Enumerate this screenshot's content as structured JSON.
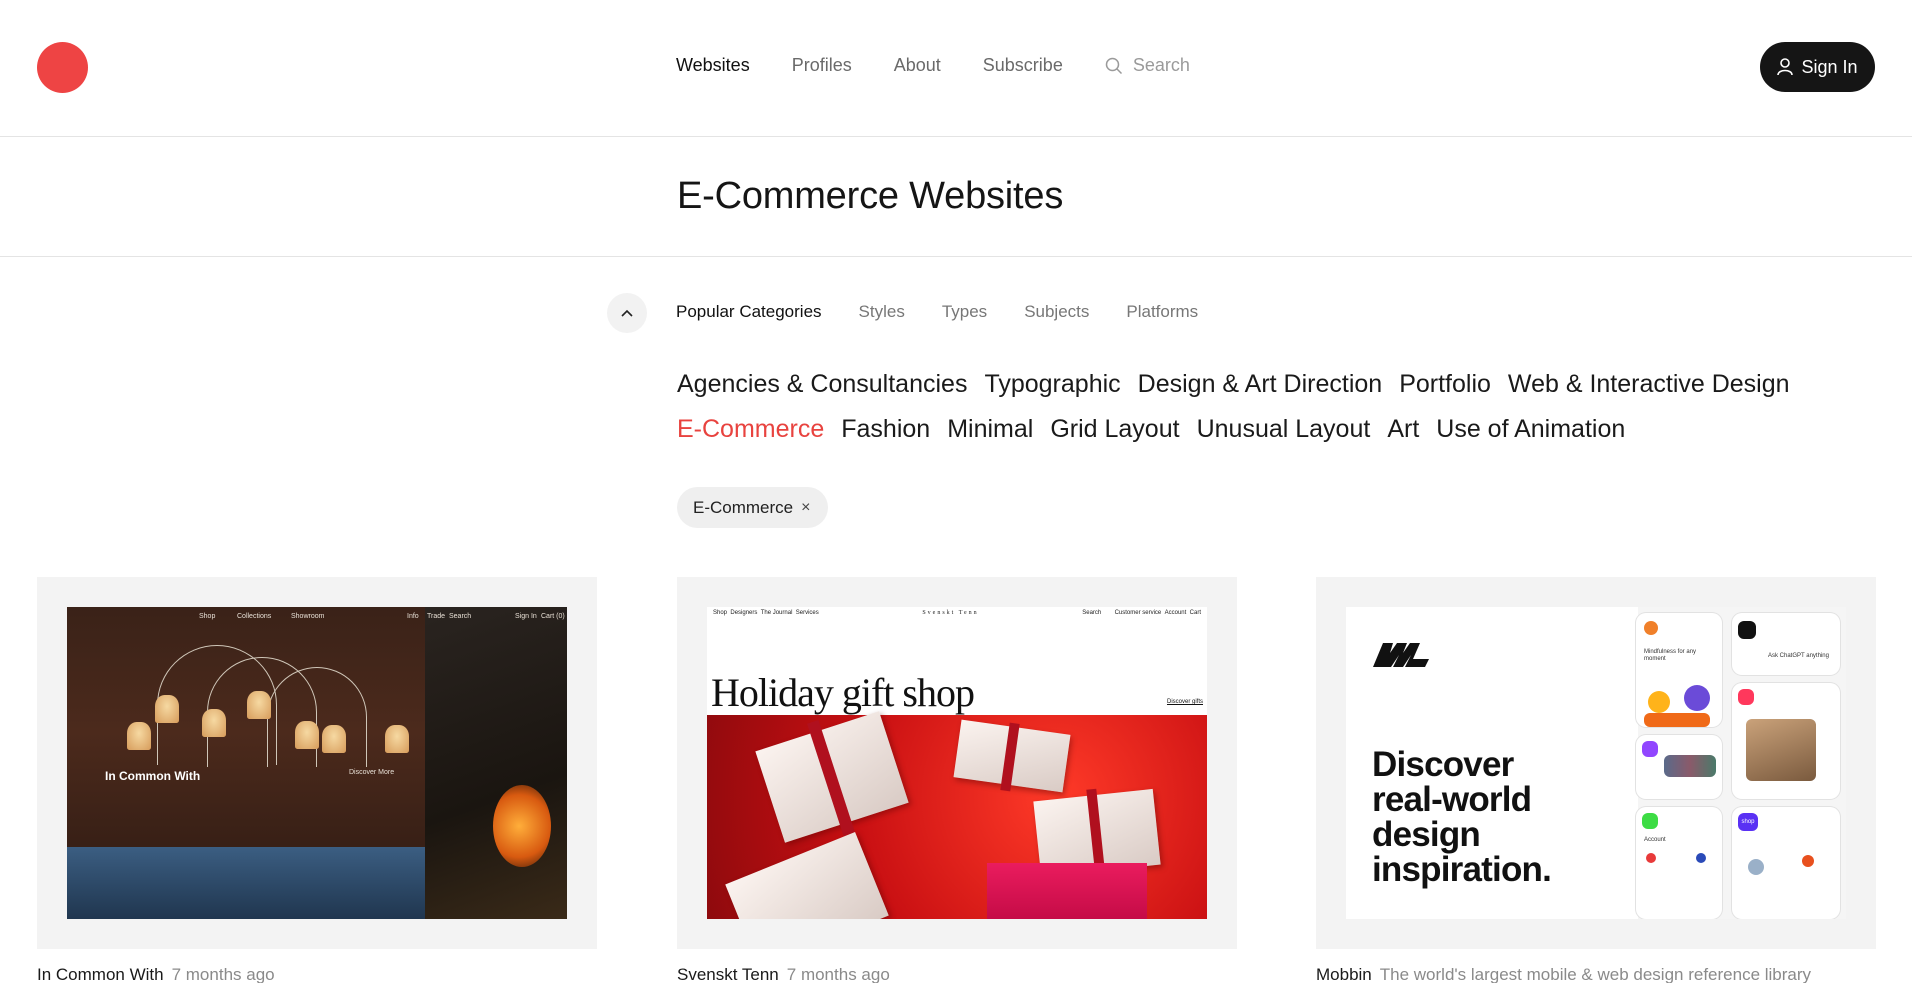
{
  "header": {
    "nav": [
      "Websites",
      "Profiles",
      "About",
      "Subscribe"
    ],
    "search_placeholder": "Search",
    "signin_label": "Sign In"
  },
  "page": {
    "title": "E-Commerce Websites"
  },
  "filters": {
    "tabs": [
      "Popular Categories",
      "Styles",
      "Types",
      "Subjects",
      "Platforms"
    ],
    "categories": [
      "Agencies & Consultancies",
      "Typographic",
      "Design & Art Direction",
      "Portfolio",
      "Web & Interactive Design",
      "E-Commerce",
      "Fashion",
      "Minimal",
      "Grid Layout",
      "Unusual Layout",
      "Art",
      "Use of Animation"
    ],
    "active_category": "E-Commerce",
    "chip_label": "E-Commerce",
    "chip_remove": "×"
  },
  "colors": {
    "accent": "#e8433f",
    "logo": "#ee4444",
    "signin_bg": "#151515"
  },
  "cards": [
    {
      "name": "In Common With",
      "subtitle": "7 months ago",
      "screenshot": {
        "nav_center": [
          "Shop",
          "Collections",
          "Showroom"
        ],
        "nav_right": [
          "Info",
          "Trade",
          "Search"
        ],
        "nav_account": [
          "Sign In",
          "Cart (0)"
        ],
        "brand": "In Common With",
        "link": "Discover More"
      }
    },
    {
      "name": "Svenskt Tenn",
      "subtitle": "7 months ago",
      "screenshot": {
        "nav_left": [
          "Shop",
          "Designers",
          "The Journal",
          "Services"
        ],
        "logo_text": "Svenskt Tenn",
        "nav_right": [
          "Search",
          "Customer service",
          "Account",
          "Cart"
        ],
        "headline": "Holiday gift shop",
        "link": "Discover gifts"
      }
    },
    {
      "name": "Mobbin",
      "subtitle": "The world's largest mobile & web design reference library",
      "screenshot": {
        "headline_lines": [
          "Discover",
          "real-world",
          "design",
          "inspiration."
        ],
        "phone_texts": [
          "Mindfulness for any moment",
          "Ask ChatGPT anything",
          "Account",
          "shop"
        ]
      }
    }
  ]
}
